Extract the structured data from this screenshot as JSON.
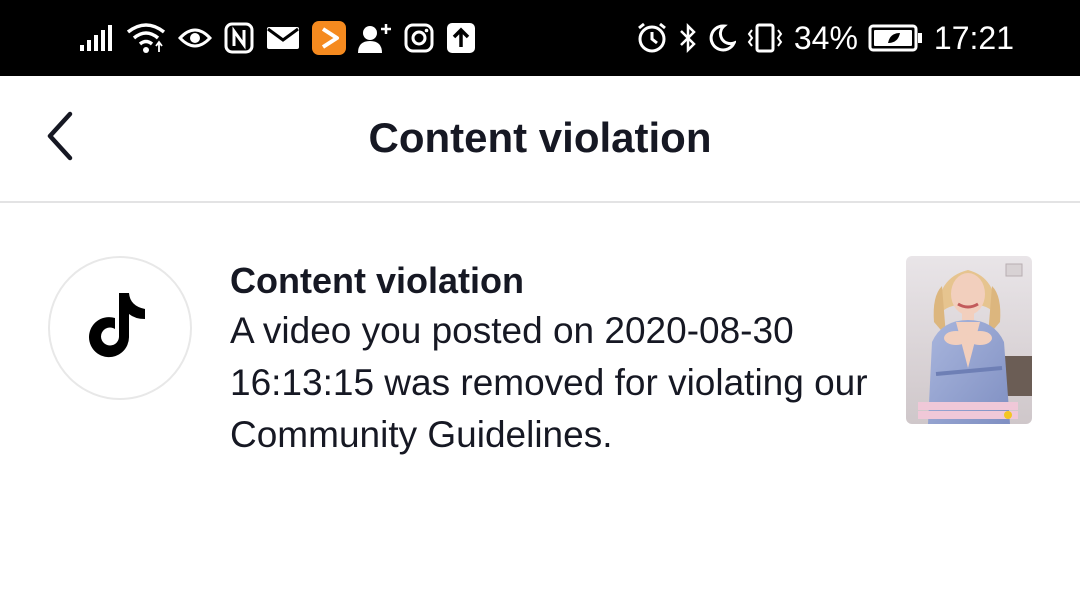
{
  "status_bar": {
    "battery_percent": "34%",
    "time": "17:21",
    "left_icons": [
      "signal-icon",
      "wifi-icon",
      "eye-icon",
      "nfc-icon",
      "mail-icon",
      "play-app-icon",
      "add-person-icon",
      "instagram-icon",
      "upload-icon"
    ],
    "right_icons": [
      "alarm-icon",
      "bluetooth-icon",
      "moon-icon",
      "vibrate-icon",
      "battery-icon"
    ]
  },
  "header": {
    "title": "Content violation",
    "back_icon": "chevron-left-icon"
  },
  "notification": {
    "icon": "tiktok-logo-icon",
    "title": "Content violation",
    "body": "A video you posted on 2020-08-30 16:13:15 was removed for violating our Community Guidelines."
  },
  "colors": {
    "status_bar_bg": "#000000",
    "text_primary": "#161823",
    "divider": "#e3e3e4",
    "accent_orange": "#f58a1f"
  }
}
